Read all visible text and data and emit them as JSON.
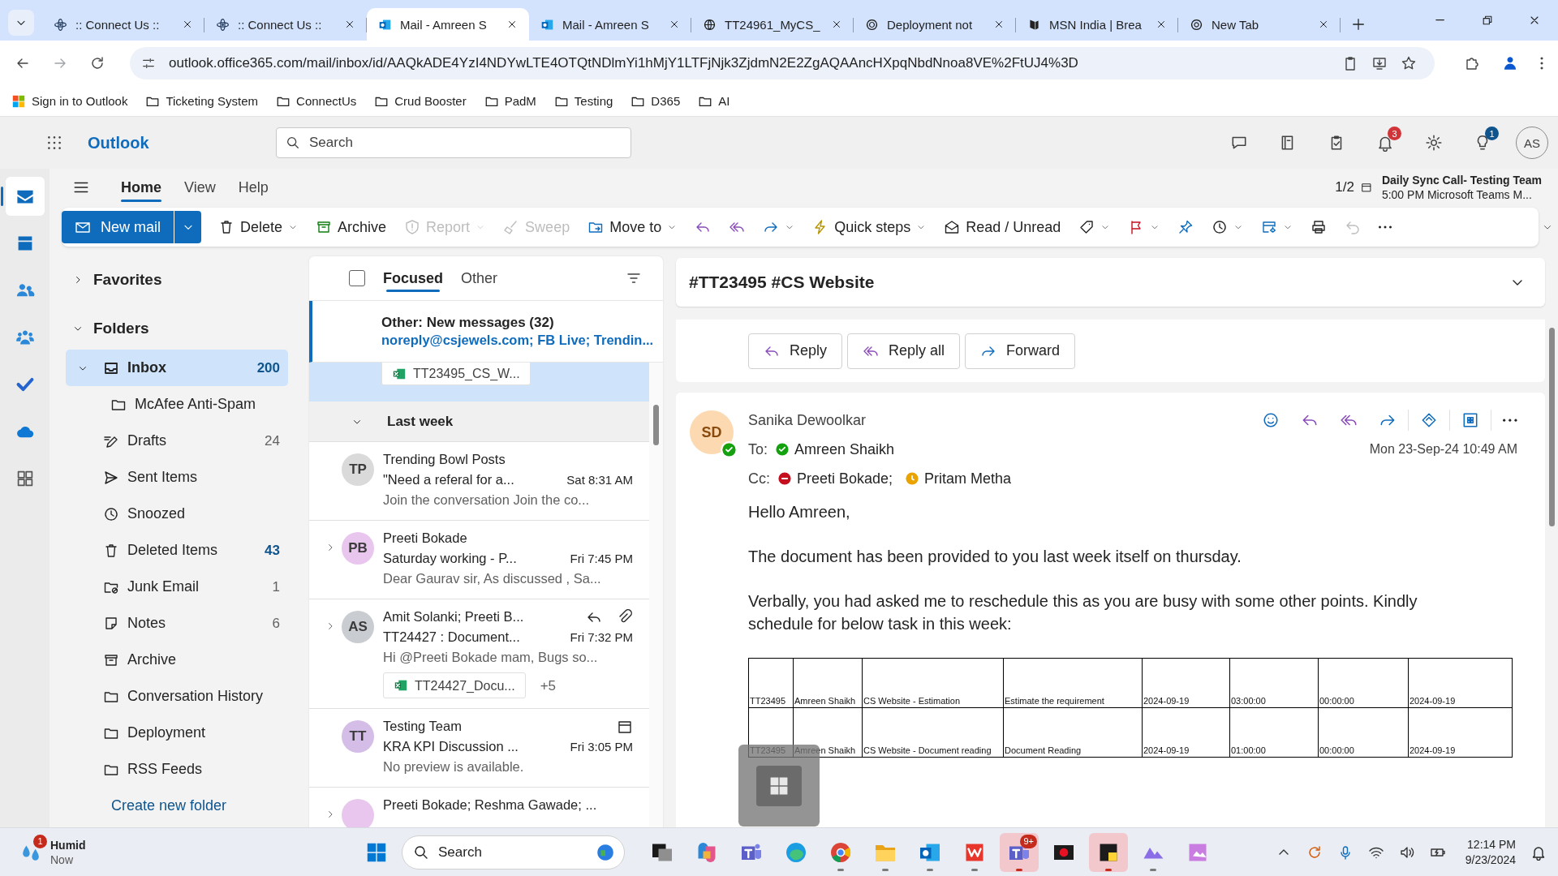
{
  "browser": {
    "tabs": [
      {
        "title": ":: Connect Us ::",
        "selected": false
      },
      {
        "title": ":: Connect Us ::",
        "selected": false
      },
      {
        "title": "Mail - Amreen S",
        "selected": true
      },
      {
        "title": "Mail - Amreen S",
        "selected": false
      },
      {
        "title": "TT24961_MyCS_",
        "selected": false
      },
      {
        "title": "Deployment not",
        "selected": false
      },
      {
        "title": "MSN India | Brea",
        "selected": false
      },
      {
        "title": "New Tab",
        "selected": false
      }
    ],
    "url": "outlook.office365.com/mail/inbox/id/AAQkADE4YzI4NDYwLTE4OTQtNDlmYi1hMjY1LTFjNjk3ZjdmN2E2ZgAQAAncHXpqNbdNnoa8VE%2FtUJ4%3D",
    "bookmarks": [
      "Sign in to Outlook",
      "Ticketing System",
      "ConnectUs",
      "Crud Booster",
      "PadM",
      "Testing",
      "D365",
      "AI"
    ]
  },
  "outlook": {
    "app_name": "Outlook",
    "search_placeholder": "Search",
    "notification_count": "3",
    "tips_count": "1",
    "account_initials": "AS"
  },
  "rail": [
    {
      "selected": true
    },
    {
      "selected": false
    },
    {
      "selected": false
    },
    {
      "selected": false
    },
    {
      "selected": false
    },
    {
      "selected": false
    },
    {
      "selected": false
    }
  ],
  "ribbon": {
    "tabs": [
      {
        "label": "Home",
        "selected": true
      },
      {
        "label": "View",
        "selected": false
      },
      {
        "label": "Help",
        "selected": false
      }
    ],
    "reminder": {
      "counter": "1/2",
      "title": "Daily Sync Call- Testing Team",
      "detail": "5:00 PM Microsoft Teams M..."
    },
    "new_mail": "New mail",
    "commands": [
      {
        "label": "Delete",
        "disabled": false,
        "dropdown": true
      },
      {
        "label": "Archive",
        "disabled": false,
        "dropdown": false
      },
      {
        "label": "Report",
        "disabled": true,
        "dropdown": true
      },
      {
        "label": "Sweep",
        "disabled": true,
        "dropdown": false
      },
      {
        "label": "Move to",
        "disabled": false,
        "dropdown": true
      },
      {
        "disabled": false,
        "dropdown": false
      },
      {
        "disabled": false,
        "dropdown": false
      },
      {
        "disabled": false,
        "dropdown": true
      },
      {
        "label": "Quick steps",
        "disabled": false,
        "dropdown": true
      },
      {
        "label": "Read / Unread",
        "disabled": false,
        "dropdown": false
      },
      {
        "disabled": false,
        "dropdown": true
      },
      {
        "disabled": false,
        "dropdown": true
      },
      {
        "disabled": false,
        "dropdown": false
      },
      {
        "disabled": false,
        "dropdown": true
      },
      {
        "disabled": false,
        "dropdown": true
      },
      {
        "disabled": false,
        "dropdown": false
      },
      {
        "disabled": true,
        "dropdown": false
      },
      {
        "disabled": false,
        "dropdown": false
      }
    ]
  },
  "folders": {
    "favorites": {
      "label": "Favorites",
      "expanded": false
    },
    "section": {
      "label": "Folders",
      "expanded": true
    },
    "items": [
      {
        "name": "Inbox",
        "count": "200",
        "unread": true,
        "selected": true,
        "expanded": true,
        "children": [
          {
            "name": "McAfee Anti-Spam",
            "selected": false
          }
        ]
      },
      {
        "name": "Drafts",
        "count": "24",
        "unread": false,
        "selected": false
      },
      {
        "name": "Sent Items",
        "selected": false
      },
      {
        "name": "Snoozed",
        "selected": false
      },
      {
        "name": "Deleted Items",
        "count": "43",
        "unread": true,
        "selected": false
      },
      {
        "name": "Junk Email",
        "count": "1",
        "unread": false,
        "selected": false
      },
      {
        "name": "Notes",
        "count": "6",
        "unread": false,
        "selected": false
      },
      {
        "name": "Archive",
        "selected": false
      },
      {
        "name": "Conversation History",
        "selected": false
      },
      {
        "name": "Deployment",
        "selected": false
      },
      {
        "name": "RSS Feeds",
        "selected": false
      }
    ],
    "create_link": "Create new folder"
  },
  "messages": {
    "select_all": {
      "checked": false
    },
    "tabs": [
      {
        "label": "Focused",
        "selected": true
      },
      {
        "label": "Other",
        "selected": false
      }
    ],
    "banner": {
      "title": "Other: New messages (32)",
      "senders": "noreply@csjewels.com; FB Live; Trendin..."
    },
    "selected_item": {
      "attachment": "TT23495_CS_W...",
      "selected": true
    },
    "group": {
      "label": "Last week",
      "expanded": true
    },
    "items": [
      {
        "initials": "TP",
        "color": "#dadada",
        "sender": "Trending Bowl Posts",
        "subject": "\"Need a referal for a...",
        "time": "Sat 8:31 AM",
        "preview": "Join the conversation Join the co...",
        "expandable": false,
        "replied": false,
        "has_attachment": false,
        "meeting": false
      },
      {
        "initials": "PB",
        "color": "#e9c6ee",
        "sender": "Preeti Bokade",
        "subject": "Saturday working - P...",
        "time": "Fri 7:45 PM",
        "preview": "Dear Gaurav sir, As discussed , Sa...",
        "expandable": true,
        "replied": false,
        "has_attachment": false,
        "meeting": false
      },
      {
        "initials": "AS",
        "color": "#c9cdd1",
        "sender": "Amit Solanki; Preeti B...",
        "subject": "TT24427 : Document...",
        "time": "Fri 7:32 PM",
        "preview": "Hi @Preeti Bokade mam, Bugs so...",
        "expandable": true,
        "replied": true,
        "has_attachment": true,
        "meeting": false,
        "attachment": "TT24427_Docu...",
        "more_attachments": "+5"
      },
      {
        "initials": "TT",
        "color": "#d4bde6",
        "sender": "Testing Team",
        "subject": "KRA KPI Discussion ...",
        "time": "Fri 3:05 PM",
        "preview": "No preview is available.",
        "expandable": false,
        "replied": false,
        "has_attachment": false,
        "meeting": true
      },
      {
        "color": "#e9c6ee",
        "sender": "Preeti Bokade; Reshma Gawade; ...",
        "expandable": true,
        "replied": false,
        "has_attachment": false,
        "meeting": false
      }
    ]
  },
  "reading": {
    "subject": "#TT23495 #CS Website",
    "thread_actions": [
      "Reply",
      "Reply all",
      "Forward"
    ],
    "message": {
      "initials": "SD",
      "sender": "Sanika Dewoolkar",
      "sender_status": {
        "kind": "available"
      },
      "to_label": "To:",
      "to": [
        {
          "name": "Amreen Shaikh",
          "kind": "available"
        }
      ],
      "cc_label": "Cc:",
      "cc": [
        {
          "name": "Preeti Bokade;",
          "kind": "busy"
        },
        {
          "name": "Pritam Metha",
          "kind": "away"
        }
      ],
      "date": "Mon 23-Sep-24 10:49 AM",
      "body": [
        "Hello Amreen,",
        "The document has been provided to you last week itself on thursday.",
        "Verbally, you had asked me to reschedule this as you are busy with some other points. Kindly schedule for below task in this week:"
      ],
      "table": [
        [
          "TT23495",
          "Amreen Shaikh",
          "CS Website - Estimation",
          "Estimate the requirement",
          "2024-09-19",
          "03:00:00",
          "00:00:00",
          "2024-09-19"
        ],
        [
          "TT23495",
          "Amreen Shaikh",
          "CS Website - Document reading",
          "Document Reading",
          "2024-09-19",
          "01:00:00",
          "00:00:00",
          "2024-09-19"
        ]
      ]
    }
  },
  "taskbar": {
    "weather": {
      "badge": "1",
      "title": "Humid",
      "subtitle": "Now"
    },
    "search_placeholder": "Search",
    "apps": [
      {
        "running": false,
        "attention": false
      },
      {
        "running": false,
        "attention": false
      },
      {
        "running": false,
        "attention": false
      },
      {
        "running": false,
        "attention": false
      },
      {
        "running": true,
        "attention": false
      },
      {
        "running": true,
        "attention": false
      },
      {
        "running": true,
        "attention": false
      },
      {
        "running": true,
        "attention": false
      },
      {
        "running": true,
        "attention": true,
        "badge": "9+"
      },
      {
        "running": false,
        "attention": false
      },
      {
        "running": true,
        "attention": true
      },
      {
        "running": true,
        "attention": false
      },
      {
        "running": false,
        "attention": false
      }
    ],
    "time": "12:14 PM",
    "date": "9/23/2024"
  }
}
